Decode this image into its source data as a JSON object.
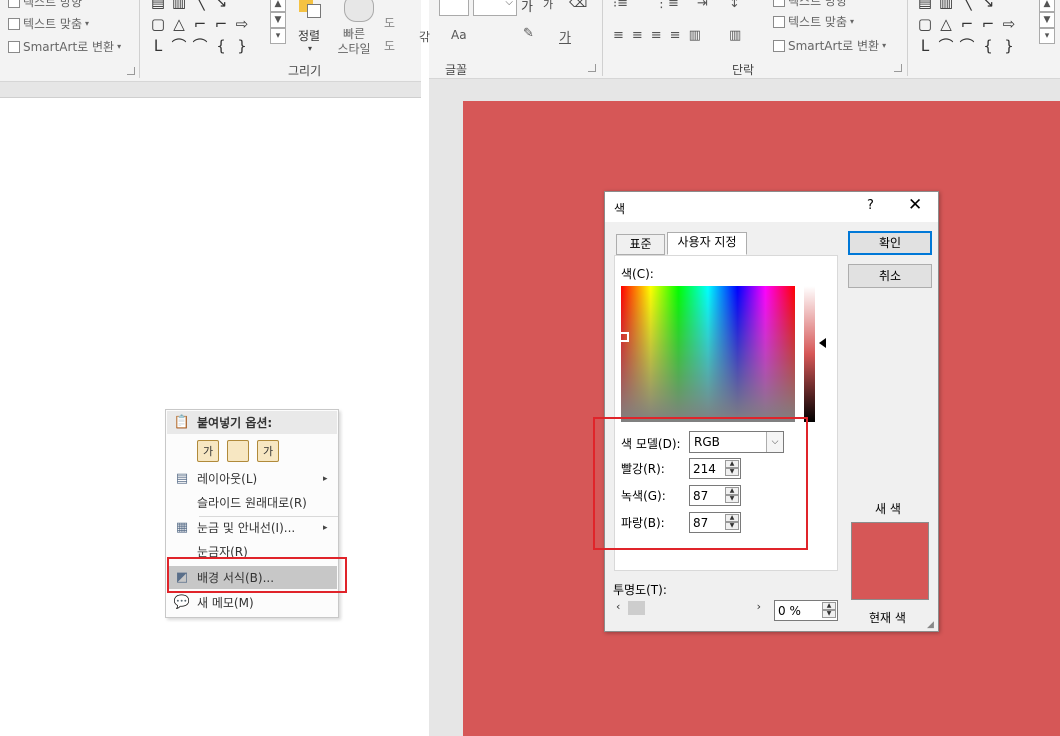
{
  "colors": {
    "slide_bg": "#D65757",
    "highlight_box": "#E0242A",
    "primary_btn_border": "#0078D7",
    "current_color": "#D65757"
  },
  "left_ribbon": {
    "item_text_direction_partial": "텍스트 방향",
    "item_text_align": "텍스트 맞춤",
    "item_smartart": "SmartArt로 변환",
    "shape_rows": [
      [
        "▤",
        "▥",
        "╲",
        "↘",
        "⌒"
      ],
      [
        "▢",
        "△",
        "⌐",
        "⌐",
        "⇨"
      ],
      [
        "ᒪ",
        "⌒",
        "⌒",
        "{",
        "}"
      ]
    ],
    "arrange_label": "정렬",
    "quick_styles_label": "빠른\n스타일",
    "drawing_group_label": "그리기",
    "partial_labels": [
      "도",
      "도"
    ]
  },
  "context_menu": {
    "header": "붙여넣기 옵션:",
    "paste_icons": [
      {
        "icon": "paste-dest-theme-icon",
        "glyph": "가"
      },
      {
        "icon": "paste-picture-icon",
        "glyph": ""
      },
      {
        "icon": "paste-text-only-icon",
        "glyph": "가"
      }
    ],
    "items": [
      {
        "label": "레이아웃(L)",
        "icon": "layout-icon",
        "has_submenu": true
      },
      {
        "label": "슬라이드 원래대로(R)",
        "icon": "",
        "has_submenu": false
      },
      {
        "label": "눈금 및 안내선(I)...",
        "icon": "grid-icon",
        "has_submenu": true
      },
      {
        "label": "눈금자(R)",
        "icon": "",
        "has_submenu": false
      },
      {
        "label": "배경 서식(B)...",
        "icon": "format-background-icon",
        "has_submenu": false
      },
      {
        "label": "새 메모(M)",
        "icon": "new-comment-icon",
        "has_submenu": false
      }
    ]
  },
  "right_ribbon": {
    "font_group_label": "글꼴",
    "paragraph_group_label": "단락",
    "text_align_label": "텍스트 맞춤",
    "smartart_label": "SmartArt로 변환",
    "text_direction_partial": "텍스트 방향",
    "font_btn_a": "가",
    "font_btn_b": "가",
    "font_btn_c": "갂",
    "aa_label": "Aa",
    "gaga_label": "가"
  },
  "color_dialog": {
    "title": "색",
    "help": "?",
    "close": "✕",
    "tabs": [
      "표준",
      "사용자 지정"
    ],
    "active_tab": "사용자 지정",
    "ok_button": "확인",
    "cancel_button": "취소",
    "colors_label": "색(C):",
    "color_model_label": "색 모델(D):",
    "color_model_value": "RGB",
    "red_label": "빨강(R):",
    "red_value": "214",
    "green_label": "녹색(G):",
    "green_value": "87",
    "blue_label": "파랑(B):",
    "blue_value": "87",
    "transparency_label": "투명도(T):",
    "transparency_value": "0 %",
    "new_color_label": "새 색",
    "current_color_label": "현재 색"
  }
}
